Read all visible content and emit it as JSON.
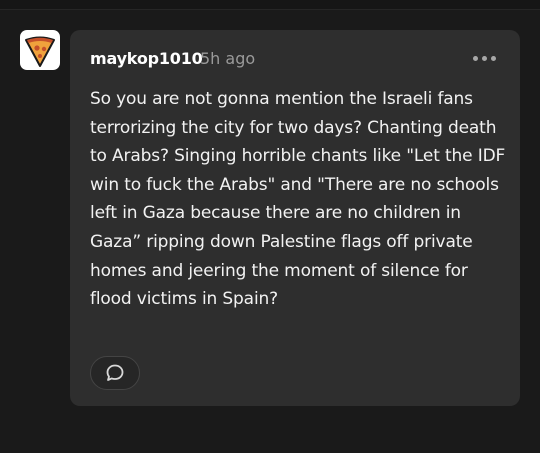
{
  "post": {
    "username": "maykop1010",
    "timestamp": "5h ago",
    "body": "So you are not gonna mention the Israeli fans terrorizing the city for two days? Chanting death to Arabs? Singing horrible chants like \"Let the IDF win to fuck the Arabs\" and \"There are no schools left in Gaza because there are no children in Gaza” ripping down Palestine flags off private homes and jeering the moment of silence for flood victims in Spain?",
    "avatar_icon": "pizza-slice-icon",
    "more_icon": "more-options-icon",
    "reply_icon": "speech-bubble-icon"
  },
  "colors": {
    "background": "#1a1a1a",
    "card": "#2e2e2e",
    "text": "#f2f2f2",
    "muted": "#9a9a9a",
    "avatar_accent": "#e8703a"
  }
}
